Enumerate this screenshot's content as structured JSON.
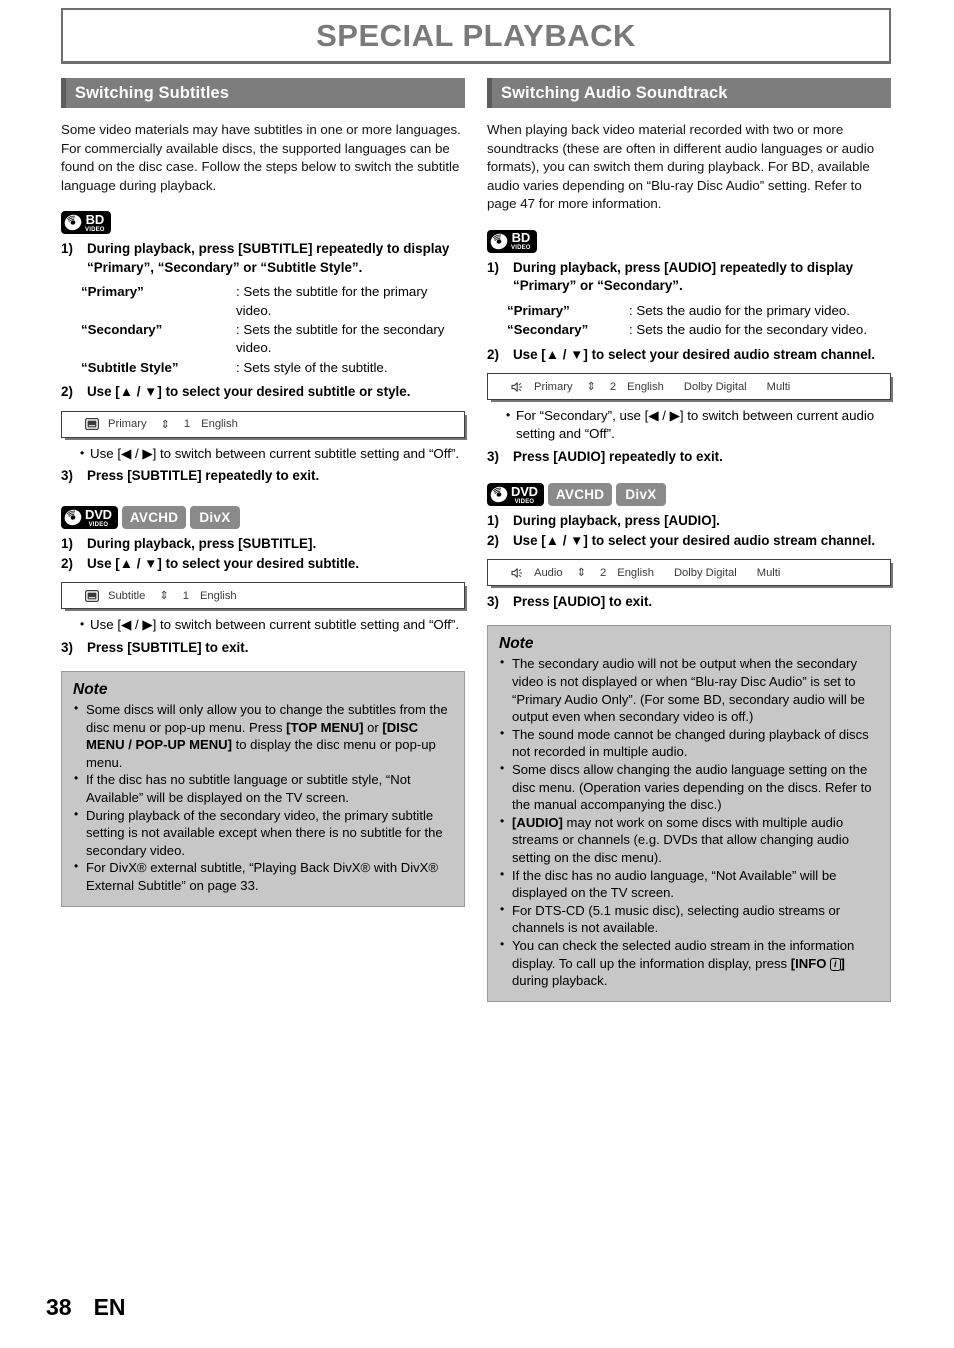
{
  "page": {
    "chapter_title": "SPECIAL PLAYBACK",
    "page_number": "38",
    "language_code": "EN"
  },
  "badges": {
    "bd_line1": "BD",
    "bd_line2": "VIDEO",
    "dvd_line1": "DVD",
    "dvd_line2": "VIDEO",
    "avchd": "AVCHD",
    "divx": "DivX"
  },
  "left": {
    "section_title": "Switching Subtitles",
    "intro": "Some video materials may have subtitles in one or more languages. For commercially available discs, the supported languages can be found on the disc case. Follow the steps below to switch the subtitle language during playback.",
    "bd": {
      "step1_num": "1)",
      "step1_text": "During playback, press [SUBTITLE] repeatedly to display “Primary”, “Secondary” or “Subtitle Style”.",
      "defs": [
        {
          "term": "“Primary”",
          "desc": ": Sets the subtitle for the primary video."
        },
        {
          "term": "“Secondary”",
          "desc": ": Sets the subtitle for the secondary video."
        },
        {
          "term": "“Subtitle Style”",
          "desc": ": Sets style of the subtitle."
        }
      ],
      "step2_num": "2)",
      "step2_text": "Use [▲ / ▼] to select your desired subtitle or style.",
      "osd": {
        "icon": "subtitle-icon",
        "label": "Primary",
        "updown": "⇕",
        "number": "1",
        "language": "English"
      },
      "bullet": "Use [◀ / ▶] to switch between current subtitle setting and “Off”.",
      "step3_num": "3)",
      "step3_text": "Press [SUBTITLE] repeatedly to exit."
    },
    "dvd": {
      "step1_num": "1)",
      "step1_text": "During playback, press [SUBTITLE].",
      "step2_num": "2)",
      "step2_text": "Use [▲ / ▼] to select your desired subtitle.",
      "osd": {
        "icon": "subtitle-icon",
        "label": "Subtitle",
        "updown": "⇕",
        "number": "1",
        "language": "English"
      },
      "bullet": "Use [◀ / ▶] to switch between current subtitle setting and “Off”.",
      "step3_num": "3)",
      "step3_text": "Press [SUBTITLE] to exit."
    },
    "note": {
      "title": "Note",
      "items": [
        "Some discs will only allow you to change the subtitles from the disc menu or pop-up menu. Press [TOP MENU] or [DISC MENU / POP-UP MENU] to display the disc menu or pop-up menu.",
        "If the disc has no subtitle language or subtitle style, “Not Available” will be displayed on the TV screen.",
        "During playback of the secondary video, the primary subtitle setting is not available except when there is no subtitle for the secondary video.",
        "For DivX® external subtitle, “Playing Back DivX® with DivX® External Subtitle” on page 33."
      ]
    }
  },
  "right": {
    "section_title": "Switching Audio Soundtrack",
    "intro": "When playing back video material recorded with two or more soundtracks (these are often in different audio languages or audio formats), you can switch them during playback. For BD, available audio varies depending on “Blu-ray Disc Audio” setting. Refer to page 47 for more information.",
    "bd": {
      "step1_num": "1)",
      "step1_text": "During playback, press [AUDIO] repeatedly to display “Primary” or “Secondary”.",
      "defs": [
        {
          "term": "“Primary”",
          "desc": ": Sets the audio for the primary video."
        },
        {
          "term": "“Secondary”",
          "desc": ": Sets the audio for the secondary video."
        }
      ],
      "step2_num": "2)",
      "step2_text": "Use [▲ / ▼] to select your desired audio stream channel.",
      "osd": {
        "icon": "speaker-icon",
        "label": "Primary",
        "updown": "⇕",
        "number": "2",
        "language": "English",
        "format": "Dolby Digital",
        "channel": "Multi"
      },
      "bullet": "For “Secondary”, use [◀ / ▶] to switch between current audio setting and “Off”.",
      "step3_num": "3)",
      "step3_text": "Press [AUDIO] repeatedly to exit."
    },
    "dvd": {
      "step1_num": "1)",
      "step1_text": "During playback, press [AUDIO].",
      "step2_num": "2)",
      "step2_text": "Use [▲ / ▼] to select your desired audio stream channel.",
      "osd": {
        "icon": "speaker-icon",
        "label": "Audio",
        "updown": "⇕",
        "number": "2",
        "language": "English",
        "format": "Dolby Digital",
        "channel": "Multi"
      },
      "step3_num": "3)",
      "step3_text": "Press [AUDIO] to exit."
    },
    "note": {
      "title": "Note",
      "items": [
        "The secondary audio will not be output when the secondary video is not displayed or when “Blu-ray Disc Audio” is set to “Primary Audio Only”. (For some BD, secondary audio will be output even when secondary video is off.)",
        "The sound mode cannot be changed during playback of discs not recorded in multiple audio.",
        "Some discs allow changing the audio language setting on the disc menu. (Operation varies depending on the discs. Refer to the manual accompanying the disc.)",
        "[AUDIO] may not work on some discs with multiple audio streams or channels (e.g. DVDs that allow changing audio setting on the disc menu).",
        "If the disc has no audio language, “Not Available” will be displayed on the TV screen.",
        "For DTS-CD (5.1 music disc), selecting audio streams or channels is not available.",
        "You can check the selected audio stream in the information display. To call up the information display, press [INFO i] during playback."
      ]
    }
  },
  "colors": {
    "section_bar": "#7d7d7d",
    "section_accent": "#5c5c5c",
    "title_text": "#7a7a7a",
    "note_bg": "#c7c7c7",
    "badge_gray": "#8a8a8a",
    "badge_black": "#000000"
  }
}
